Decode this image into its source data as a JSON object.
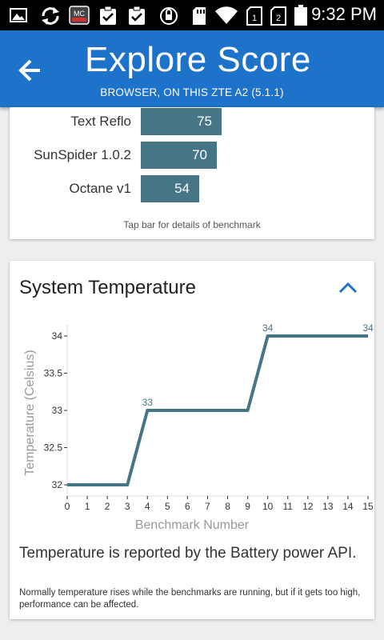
{
  "status_bar": {
    "time": "9:32 PM",
    "icons": [
      "image-icon",
      "sync-icon",
      "mc-app-icon",
      "clipboard-check-icon",
      "clipboard-check-icon",
      "vpn-icon",
      "sd-card-icon",
      "wifi-icon",
      "sim-icon",
      "sim-icon",
      "battery-icon"
    ]
  },
  "app_bar": {
    "title": "Explore Score",
    "subtitle": "BROWSER, ON THIS ZTE A2 (5.1.1)",
    "back_icon": "arrow-left-icon",
    "color": "#1d72c9"
  },
  "benchmarks": {
    "items": [
      {
        "label": "Text Reflo",
        "value": "75"
      },
      {
        "label": "SunSpider 1.0.2",
        "value": "70"
      },
      {
        "label": "Octane v1",
        "value": "54"
      }
    ],
    "bar_color": "#467585",
    "hint": "Tap bar for details of benchmark"
  },
  "temperature": {
    "title": "System Temperature",
    "collapse_icon": "chevron-up-icon",
    "note": "Temperature is reported by the Battery power API.",
    "description": "Normally temperature rises while the benchmarks are running, but if it gets too high, performance can be affected."
  },
  "chart_data": {
    "type": "line",
    "title": "",
    "xlabel": "Benchmark Number",
    "ylabel": "Temperature (Celsius)",
    "x": [
      0,
      3,
      4,
      9,
      10,
      15
    ],
    "y": [
      32,
      32,
      33,
      33,
      34,
      34
    ],
    "xticks": [
      0,
      1,
      2,
      3,
      4,
      5,
      6,
      7,
      8,
      9,
      10,
      11,
      12,
      13,
      14,
      15
    ],
    "yticks": [
      32,
      32.5,
      33,
      33.5,
      34
    ],
    "xlim": [
      0,
      15
    ],
    "ylim": [
      31.85,
      34.15
    ],
    "point_labels": [
      {
        "x": 4,
        "y": 33,
        "text": "33"
      },
      {
        "x": 10,
        "y": 34,
        "text": "34"
      },
      {
        "x": 15,
        "y": 34,
        "text": "34"
      }
    ],
    "line_color": "#467585",
    "grid": false
  }
}
